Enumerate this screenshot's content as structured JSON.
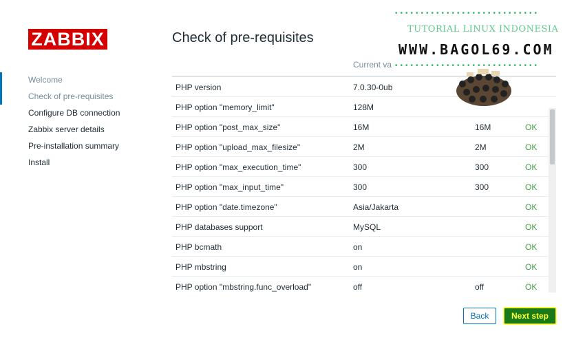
{
  "logo": "ZABBIX",
  "sidebar": {
    "steps": [
      {
        "label": "Welcome"
      },
      {
        "label": "Check of pre-requisites"
      },
      {
        "label": "Configure DB connection"
      },
      {
        "label": "Zabbix server details"
      },
      {
        "label": "Pre-installation summary"
      },
      {
        "label": "Install"
      }
    ]
  },
  "page_title": "Check of pre-requisites",
  "table": {
    "header_current": "Current va",
    "rows": [
      {
        "name": "PHP version",
        "current": "7.0.30-0ub",
        "required": "",
        "status": ""
      },
      {
        "name": "PHP option \"memory_limit\"",
        "current": "128M",
        "required": "",
        "status": ""
      },
      {
        "name": "PHP option \"post_max_size\"",
        "current": "16M",
        "required": "16M",
        "status": "OK"
      },
      {
        "name": "PHP option \"upload_max_filesize\"",
        "current": "2M",
        "required": "2M",
        "status": "OK"
      },
      {
        "name": "PHP option \"max_execution_time\"",
        "current": "300",
        "required": "300",
        "status": "OK"
      },
      {
        "name": "PHP option \"max_input_time\"",
        "current": "300",
        "required": "300",
        "status": "OK"
      },
      {
        "name": "PHP option \"date.timezone\"",
        "current": "Asia/Jakarta",
        "required": "",
        "status": "OK"
      },
      {
        "name": "PHP databases support",
        "current": "MySQL",
        "required": "",
        "status": "OK"
      },
      {
        "name": "PHP bcmath",
        "current": "on",
        "required": "",
        "status": "OK"
      },
      {
        "name": "PHP mbstring",
        "current": "on",
        "required": "",
        "status": "OK"
      },
      {
        "name": "PHP option \"mbstring.func_overload\"",
        "current": "off",
        "required": "off",
        "status": "OK"
      }
    ]
  },
  "buttons": {
    "back": "Back",
    "next": "Next step"
  },
  "watermark": {
    "dots": "••••••••••••••••••••••••••••",
    "title": "TUTORIAL LINUX INDONESIA",
    "url": "WWW.BAGOL69.COM"
  },
  "colors": {
    "brand_red": "#d40000",
    "ok_green": "#429e47",
    "link_blue": "#0275b8",
    "next_bg": "#1a7a1a",
    "next_text": "#ffff33"
  }
}
